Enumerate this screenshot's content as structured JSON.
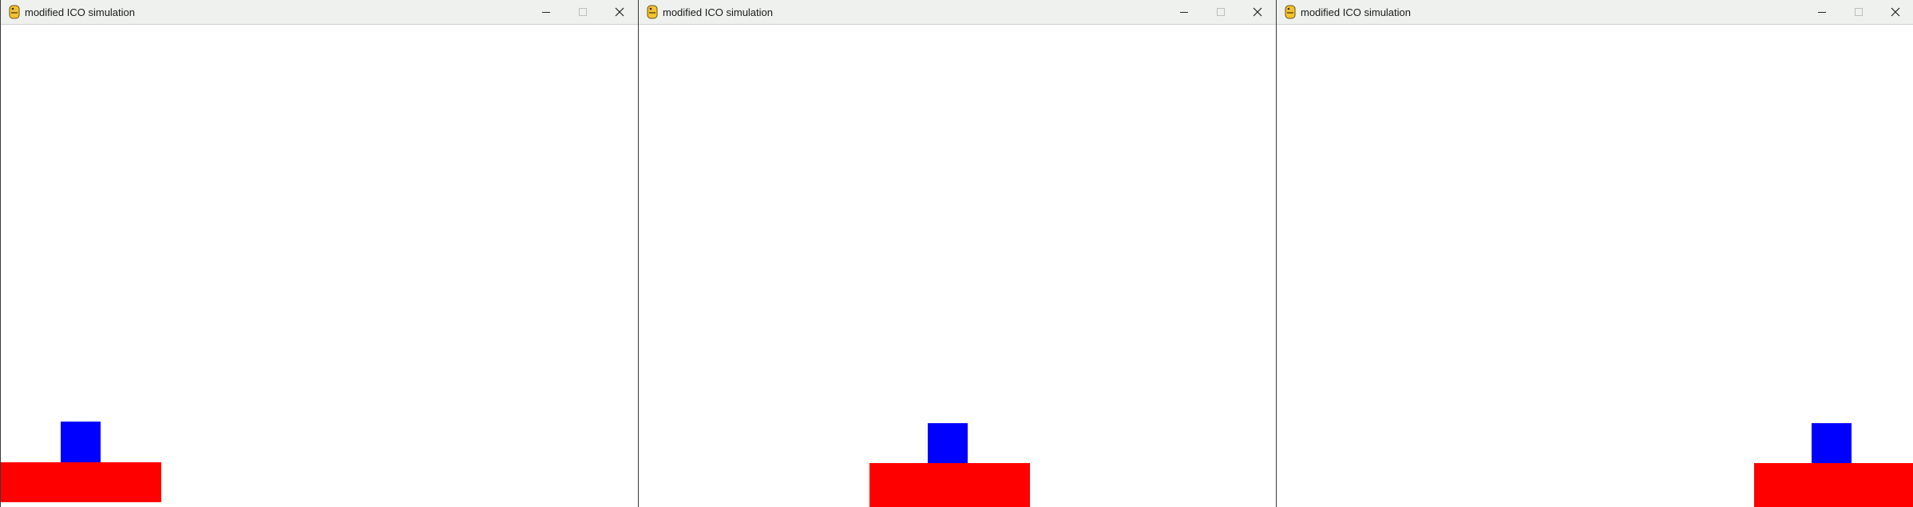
{
  "windows": [
    {
      "title": "modified ICO simulation",
      "controls": [
        "minimize-icon",
        "maximize-icon",
        "close-icon"
      ],
      "scene": {
        "platform_color": "#ff0000",
        "box_color": "#0000ff"
      }
    },
    {
      "title": "modified ICO simulation",
      "controls": [
        "minimize-icon",
        "maximize-icon",
        "close-icon"
      ],
      "scene": {
        "platform_color": "#ff0000",
        "box_color": "#0000ff"
      }
    },
    {
      "title": "modified ICO simulation",
      "controls": [
        "minimize-icon",
        "maximize-icon",
        "close-icon"
      ],
      "scene": {
        "platform_color": "#ff0000",
        "box_color": "#0000ff"
      }
    }
  ]
}
